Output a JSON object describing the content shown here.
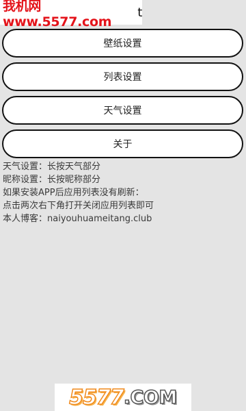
{
  "watermark_top": {
    "text": "我机网 www.5577.com",
    "tail": "t"
  },
  "menu": {
    "wallpaper_label": "壁纸设置",
    "list_label": "列表设置",
    "weather_label": "天气设置",
    "about_label": "关于"
  },
  "info": {
    "lines": [
      "天气设置：长按天气部分",
      "昵称设置：长按昵称部分",
      "如果安装APP后应用列表没有刷新：",
      "点击两次右下角打开关闭应用列表即可",
      "本人博客：naiyouhuameitang.club"
    ]
  },
  "watermark_bottom": {
    "number": "5577",
    "suffix": ".COM"
  },
  "colors": {
    "background": "#e4e4e4",
    "button_fill": "#ffffff",
    "button_border": "#111111",
    "watermark_red": "#e4141b",
    "watermark_orange": "#f08a1c"
  }
}
